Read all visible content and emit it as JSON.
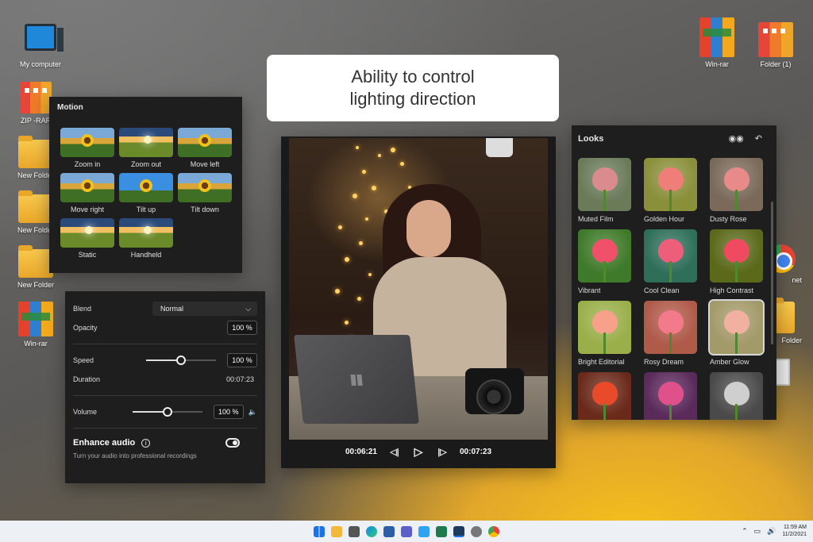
{
  "desktop": {
    "icons": [
      {
        "label": "My computer"
      },
      {
        "label": "ZIP -RAR"
      },
      {
        "label": "New Folder"
      },
      {
        "label": "New Folder"
      },
      {
        "label": "New Folder"
      },
      {
        "label": "Win-rar"
      },
      {
        "label": "Win-rar"
      },
      {
        "label": "Folder (1)"
      },
      {
        "label": "net"
      },
      {
        "label": "Folder"
      }
    ]
  },
  "title_card": {
    "line1": "Ability to control",
    "line2": "lighting direction"
  },
  "motion": {
    "title": "Motion",
    "items": [
      {
        "label": "Zoom in"
      },
      {
        "label": "Zoom out"
      },
      {
        "label": "Move left"
      },
      {
        "label": "Move right"
      },
      {
        "label": "Tilt up"
      },
      {
        "label": "Tilt down"
      },
      {
        "label": "Static"
      },
      {
        "label": "Handheld"
      }
    ]
  },
  "properties": {
    "blend_label": "Blend",
    "blend_value": "Normal",
    "opacity_label": "Opacity",
    "opacity_value": "100 %",
    "speed_label": "Speed",
    "speed_value": "100 %",
    "speed_level": 0.5,
    "duration_label": "Duration",
    "duration_value": "00:07:23",
    "volume_label": "Volume",
    "volume_value": "100 %",
    "volume_level": 0.5,
    "enhance_label": "Enhance audio",
    "enhance_note": "Turn your audio into professional recordings"
  },
  "player": {
    "current_time": "00:06:21",
    "total_time": "00:07:23"
  },
  "looks": {
    "title": "Looks",
    "items": [
      {
        "label": "Muted Film",
        "flower": "#d98b8e",
        "bg": "#6b7b5a"
      },
      {
        "label": "Golden Hour",
        "flower": "#f07e78",
        "bg": "#8a8f3a"
      },
      {
        "label": "Dusty Rose",
        "flower": "#e88a8a",
        "bg": "#7b6a5a"
      },
      {
        "label": "Vibrant",
        "flower": "#f0506a",
        "bg": "#3f7a2a"
      },
      {
        "label": "Cool Clean",
        "flower": "#ec5e7a",
        "bg": "#2f6f5a"
      },
      {
        "label": "High Contrast",
        "flower": "#f04a60",
        "bg": "#5a6a1a"
      },
      {
        "label": "Bright Editorial",
        "flower": "#f7a08a",
        "bg": "#9aaf4a"
      },
      {
        "label": "Rosy Dream",
        "flower": "#f27a8a",
        "bg": "#b05a4a"
      },
      {
        "label": "Amber Glow",
        "flower": "#f2b0a0",
        "bg": "#a39a6a"
      },
      {
        "label": "",
        "flower": "#e84a2a",
        "bg": "#6a2a1a"
      },
      {
        "label": "",
        "flower": "#e0508a",
        "bg": "#5a2a5a"
      },
      {
        "label": "",
        "flower": "#cfcfcf",
        "bg": "#4a4a4a"
      }
    ]
  },
  "taskbar": {
    "time": "11:59 AM",
    "date": "11/2/2021"
  }
}
